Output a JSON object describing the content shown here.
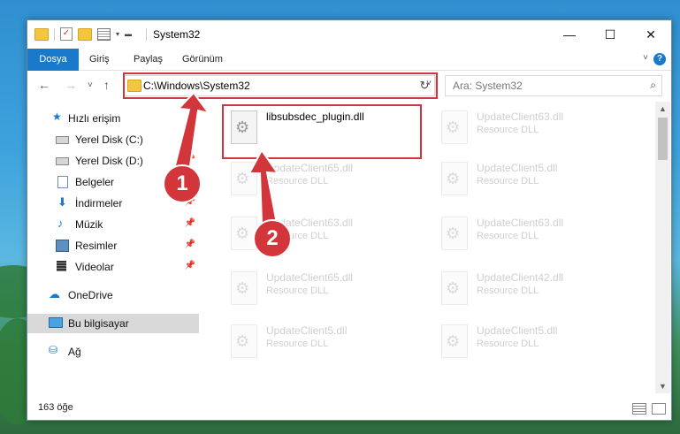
{
  "window": {
    "title": "System32",
    "minimize_icon": "minimize-icon",
    "maximize_icon": "maximize-icon",
    "close_icon": "close-icon"
  },
  "ribbon": {
    "tabs": [
      "Dosya",
      "Giriş",
      "Paylaş",
      "Görünüm"
    ],
    "help": "?"
  },
  "address": {
    "path": "C:\\Windows\\System32"
  },
  "search": {
    "placeholder": "Ara: System32"
  },
  "sidebar": {
    "items": [
      {
        "label": "Hızlı erişim",
        "icon": "star-icon",
        "pinned": false
      },
      {
        "label": "Yerel Disk (C:)",
        "icon": "drive-icon",
        "pinned": true
      },
      {
        "label": "Yerel Disk (D:)",
        "icon": "drive-icon",
        "pinned": true
      },
      {
        "label": "Belgeler",
        "icon": "document-icon",
        "pinned": true
      },
      {
        "label": "İndirmeler",
        "icon": "download-icon",
        "pinned": true
      },
      {
        "label": "Müzik",
        "icon": "music-icon",
        "pinned": true
      },
      {
        "label": "Resimler",
        "icon": "picture-icon",
        "pinned": true
      },
      {
        "label": "Videolar",
        "icon": "video-icon",
        "pinned": true
      },
      {
        "label": "OneDrive",
        "icon": "cloud-icon",
        "pinned": false
      },
      {
        "label": "Bu bilgisayar",
        "icon": "computer-icon",
        "pinned": false,
        "selected": true
      },
      {
        "label": "Ağ",
        "icon": "network-icon",
        "pinned": false
      }
    ]
  },
  "files": [
    {
      "name": "libsubsdec_plugin.dll",
      "type": "",
      "highlight": true
    },
    {
      "name": "UpdateClient63.dll",
      "type": "Resource DLL"
    },
    {
      "name": "UpdateClient65.dll",
      "type": "Resource DLL"
    },
    {
      "name": "UpdateClient5.dll",
      "type": "Resource DLL"
    },
    {
      "name": "UpdateClient63.dll",
      "type": "Resource DLL"
    },
    {
      "name": "UpdateClient63.dll",
      "type": "Resource DLL"
    },
    {
      "name": "UpdateClient65.dll",
      "type": "Resource DLL"
    },
    {
      "name": "UpdateClient42.dll",
      "type": "Resource DLL"
    },
    {
      "name": "UpdateClient5.dll",
      "type": "Resource DLL"
    },
    {
      "name": "UpdateClient5.dll",
      "type": "Resource DLL"
    }
  ],
  "status": {
    "count": "163 öğe"
  },
  "callouts": [
    "1",
    "2"
  ],
  "colors": {
    "accent": "#1979ca",
    "highlight_red": "#d2363a"
  }
}
